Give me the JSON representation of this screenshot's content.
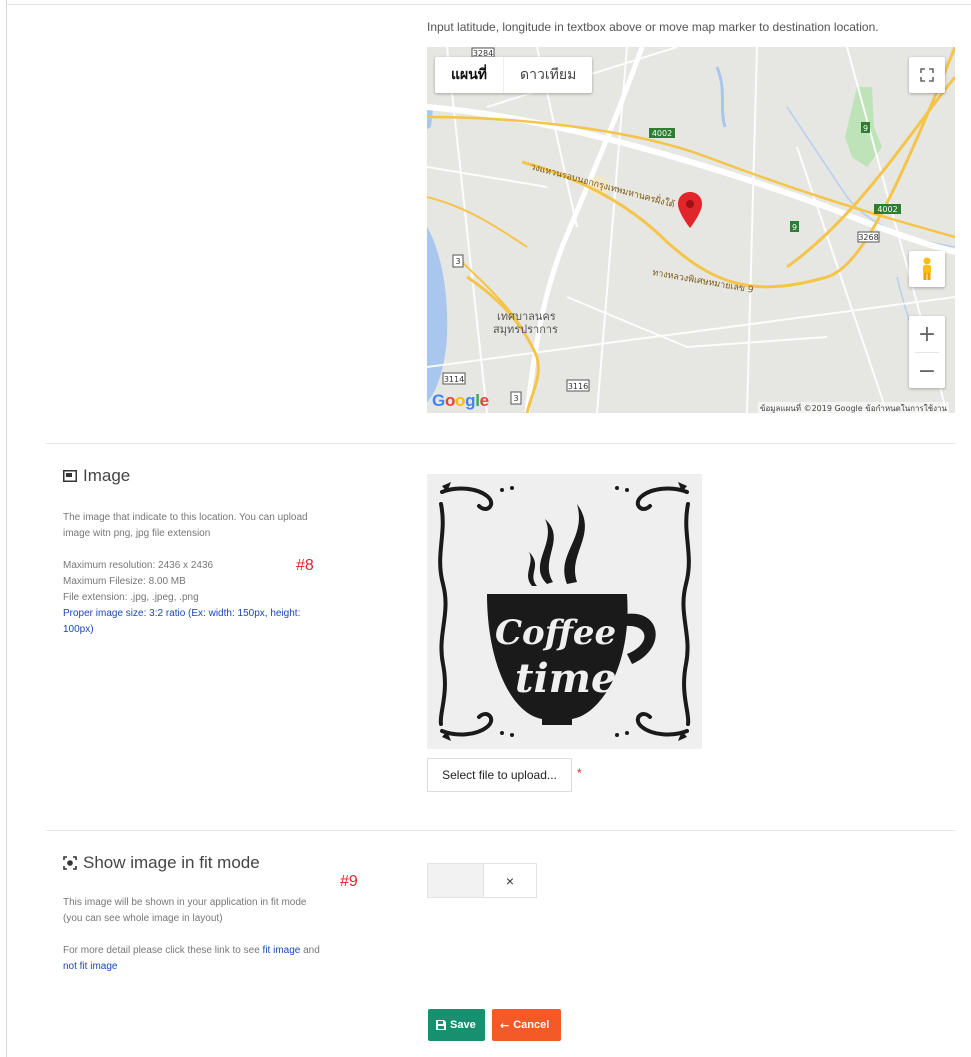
{
  "location": {
    "hint": "Input latitude, longitude in textbox above or move map marker to destination location."
  },
  "map": {
    "tabs": [
      "แผนที่",
      "ดาวเทียม"
    ],
    "zoom_in": "+",
    "zoom_out": "−",
    "city_label_line1": "เทศบาลนคร",
    "city_label_line2": "สมุทรปราการ",
    "road_labels": {
      "ring_road": "วงแหวนรอบนอกกรุงเทพมหานครฝั่งใต้",
      "motorway": "ทางหลวงพิเศษหมายเลข 9"
    },
    "route_shields": [
      "4002",
      "9",
      "4002",
      "9",
      "3268",
      "3",
      "3114",
      "3",
      "3116",
      "3284"
    ],
    "attribution": "ข้อมูลแผนที่ ©2019 Google   ข้อกำหนดในการใช้งาน",
    "logo_letters": [
      "G",
      "o",
      "o",
      "g",
      "l",
      "e"
    ],
    "colors": {
      "land": "#e6e6e3",
      "water": "#a8c6ee",
      "highway": "#f4c54a",
      "park": "#bfe3b8",
      "marker": "#e0262b"
    }
  },
  "image_section": {
    "title": "Image",
    "icon": "picture-icon",
    "desc_line1": "The image that indicate to this location. You can upload",
    "desc_line2": "image witn png, jpg file extension",
    "max_resolution": "Maximum resolution: 2436 x 2436",
    "max_filesize": "Maximum Filesize: 8.00 MB",
    "file_ext": "File extension: .jpg, .jpeg, .png",
    "proper_size_line1": "Proper image size: 3:2 ratio (Ex: width: 150px, height:",
    "proper_size_line2": "100px)",
    "annotation": "#8",
    "preview_text1": "Coffee",
    "preview_text2": "time",
    "upload_label": "Select file to upload...",
    "required_mark": "*"
  },
  "fit_section": {
    "title": "Show image in fit mode",
    "icon": "focus-icon",
    "desc_line1": "This image will be shown in your application in fit mode",
    "desc_line2": "(you can see whole image in layout)",
    "detail_prefix": "For more detail please click these link to see",
    "link_fit": "fit image",
    "and_text": "and",
    "link_not_fit": "not fit image",
    "annotation": "#9",
    "toggle_off_symbol": "×",
    "toggle_enabled": false
  },
  "actions": {
    "save_label": "Save",
    "cancel_label": "Cancel",
    "save_color": "#16906e",
    "cancel_color": "#f45a27"
  }
}
